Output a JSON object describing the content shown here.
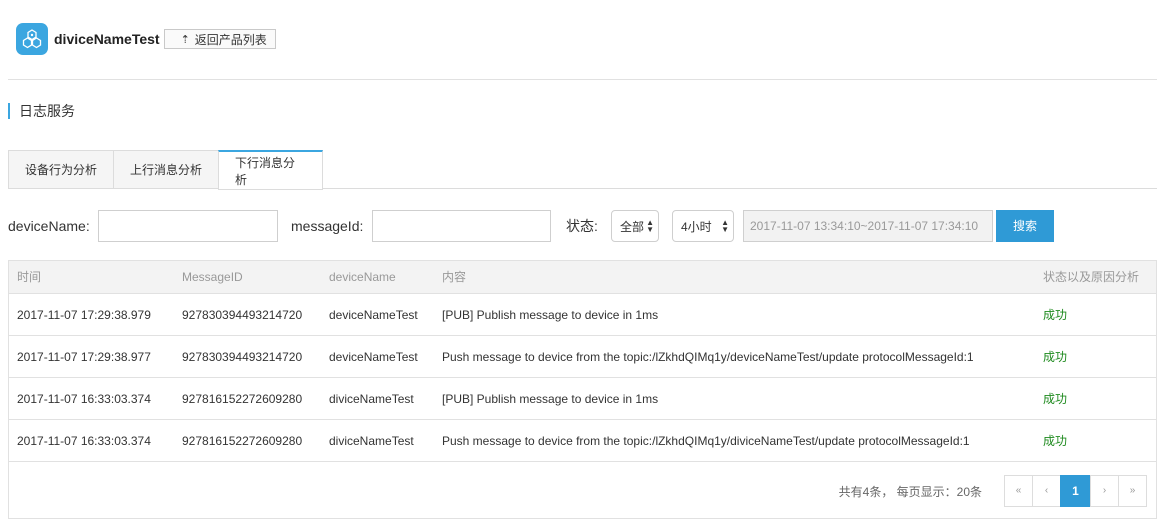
{
  "header": {
    "product_name": "diviceNameTest",
    "back_label": "返回产品列表"
  },
  "section": {
    "title": "日志服务"
  },
  "tabs": [
    {
      "label": "设备行为分析"
    },
    {
      "label": "上行消息分析"
    },
    {
      "label": "下行消息分析"
    }
  ],
  "filters": {
    "device_name_label": "deviceName:",
    "device_name_value": "",
    "message_id_label": "messageId:",
    "message_id_value": "",
    "status_label": "状态:",
    "status_value": "全部",
    "period_value": "4小时",
    "date_range": "2017-11-07 13:34:10~2017-11-07 17:34:10",
    "search_label": "搜索"
  },
  "table": {
    "columns": [
      "时间",
      "MessageID",
      "deviceName",
      "内容",
      "状态以及原因分析"
    ],
    "rows": [
      [
        "2017-11-07 17:29:38.979",
        "927830394493214720",
        "deviceNameTest",
        "[PUB] Publish message to device in 1ms",
        "成功"
      ],
      [
        "2017-11-07 17:29:38.977",
        "927830394493214720",
        "deviceNameTest",
        "Push message to device from the topic:/lZkhdQIMq1y/deviceNameTest/update protocolMessageId:1",
        "成功"
      ],
      [
        "2017-11-07 16:33:03.374",
        "927816152272609280",
        "diviceNameTest",
        "[PUB] Publish message to device in 1ms",
        "成功"
      ],
      [
        "2017-11-07 16:33:03.374",
        "927816152272609280",
        "diviceNameTest",
        "Push message to device from the topic:/lZkhdQIMq1y/diviceNameTest/update protocolMessageId:1",
        "成功"
      ]
    ]
  },
  "pagination": {
    "summary": "共有4条， 每页显示：20条",
    "first": "«",
    "prev": "‹",
    "current": "1",
    "next": "›",
    "last": "»"
  },
  "colors": {
    "accent": "#2f9ad6",
    "success": "#1e8a1e"
  }
}
